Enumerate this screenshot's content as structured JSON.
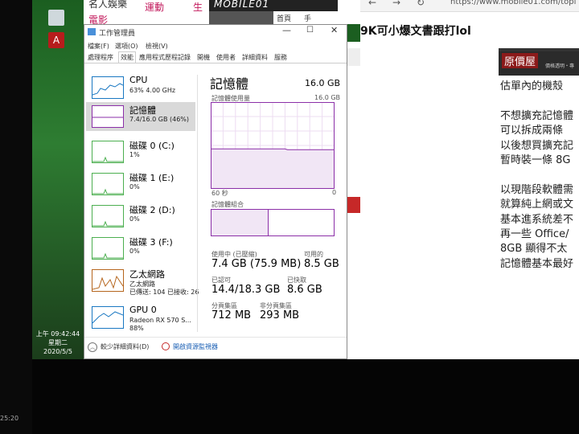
{
  "desktop": {
    "clock": {
      "time": "上午 09:42:44",
      "weekday": "星期二",
      "date": "2020/5/5"
    },
    "left_time": "25:20"
  },
  "bg_windows": {
    "left_text1": "名人娛樂",
    "left_text2": "電影",
    "left_text3": "運動",
    "left_text4": "生",
    "mobile01_logo": "MOBILE01",
    "nav1": "首頁",
    "nav2": "手",
    "browser_url": "https://www.mobile01.com/topi",
    "browser_title": "9K可小爆文書跟打lol",
    "browser_brand": "原價屋",
    "browser_brand_sub": "價格透明・專",
    "lines": [
      "估單內的機殼",
      "",
      "不想擴充記憶體",
      "可以拆成兩條",
      "以後想買擴充記",
      "暫時裝一條 8G",
      "",
      "以現階段軟體需",
      "就算純上網或文",
      "基本進系統差不",
      "再一些 Office/",
      "8GB 顯得不太",
      "記憶體基本最好"
    ]
  },
  "task_manager": {
    "title": "工作管理員",
    "menu": [
      "檔案(F)",
      "選項(O)",
      "檢視(V)"
    ],
    "tabs": [
      "處理程序",
      "效能",
      "應用程式歷程記錄",
      "開機",
      "使用者",
      "詳細資料",
      "服務"
    ],
    "active_tab": 1,
    "sidebar": [
      {
        "title": "CPU",
        "sub1": "63% 4.00 GHz",
        "sub2": "",
        "sub3": ""
      },
      {
        "title": "記憶體",
        "sub1": "7.4/16.0 GB (46%)",
        "sub2": "",
        "sub3": ""
      },
      {
        "title": "磁碟 0 (C:)",
        "sub1": "1%",
        "sub2": "",
        "sub3": ""
      },
      {
        "title": "磁碟 1 (E:)",
        "sub1": "0%",
        "sub2": "",
        "sub3": ""
      },
      {
        "title": "磁碟 2 (D:)",
        "sub1": "0%",
        "sub2": "",
        "sub3": ""
      },
      {
        "title": "磁碟 3 (F:)",
        "sub1": "0%",
        "sub2": "",
        "sub3": ""
      },
      {
        "title": "乙太網路",
        "sub1": "乙太網路",
        "sub2": "已傳送: 104 已接收: 26",
        "sub3": ""
      },
      {
        "title": "GPU 0",
        "sub1": "Radeon RX 570 S...",
        "sub2": "88%",
        "sub3": ""
      }
    ],
    "memory": {
      "heading": "記憶體",
      "total": "16.0 GB",
      "usage_label": "記憶體使用量",
      "usage_max": "16.0 GB",
      "time_left": "60 秒",
      "time_right": "0",
      "composition_label": "記憶體組合",
      "in_use_label": "使用中 (已壓縮)",
      "in_use_value": "7.4 GB (75.9 MB)",
      "available_label": "可用的",
      "available_value": "8.5 GB",
      "committed_label": "已認可",
      "committed_value": "14.4/18.3 GB",
      "cached_label": "已快取",
      "cached_value": "8.6 GB",
      "paged_label": "分頁集區",
      "paged_value": "712 MB",
      "nonpaged_label": "非分頁集區",
      "nonpaged_value": "293 MB",
      "usage_fraction": 0.46
    },
    "footer": {
      "fewer_details": "較少詳細資料(D)",
      "open_monitor": "開啟資源監視器"
    },
    "colors": {
      "memory": "#8b2fa8",
      "cpu": "#1a78c2",
      "disk": "#4caf50",
      "ethernet": "#b5651d",
      "gpu": "#1a78c2"
    }
  }
}
